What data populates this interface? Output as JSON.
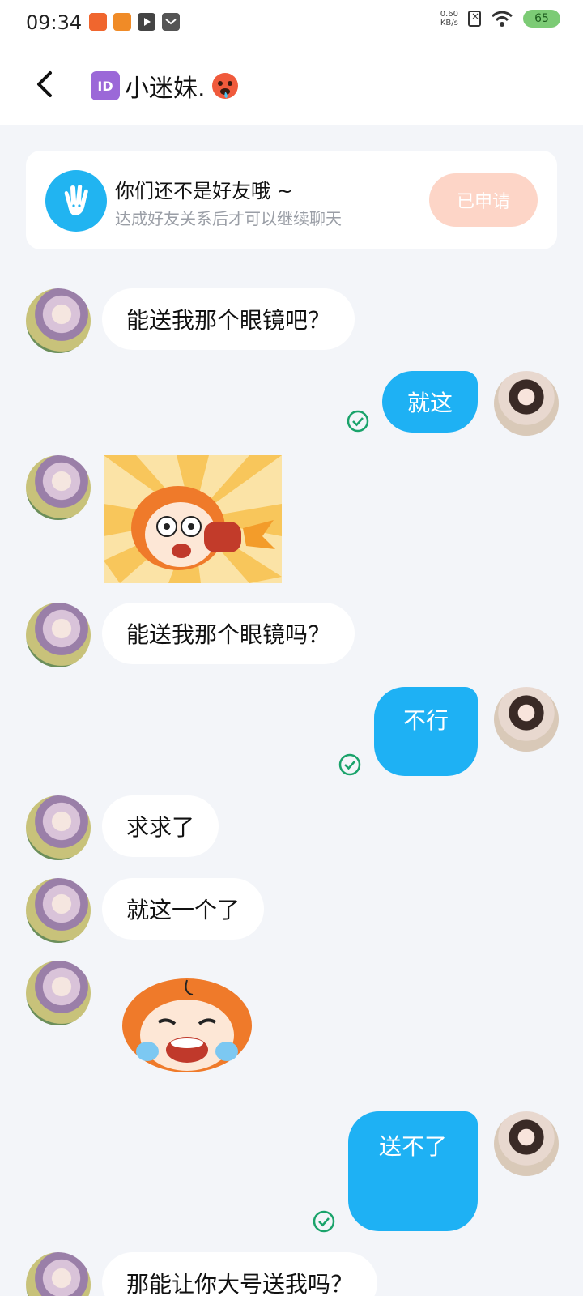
{
  "status_bar": {
    "time": "09:34",
    "net_speed_value": "0.60",
    "net_speed_unit": "KB/s",
    "battery": "65"
  },
  "header": {
    "id_badge": "ID",
    "title": "小迷妹."
  },
  "friend_notice": {
    "title": "你们还不是好友哦 ~",
    "subtitle": "达成好友关系后才可以继续聊天",
    "button_label": "已申请"
  },
  "messages": [
    {
      "from": "other",
      "type": "text",
      "text": "能送我那个眼镜吧？"
    },
    {
      "from": "self",
      "type": "text",
      "text": "就这",
      "status": "read"
    },
    {
      "from": "other",
      "type": "sticker",
      "sticker": "shocked-boxing-sticker"
    },
    {
      "from": "other",
      "type": "text",
      "text": "能送我那个眼镜吗？"
    },
    {
      "from": "self",
      "type": "text",
      "text": "不行",
      "status": "read"
    },
    {
      "from": "other",
      "type": "text",
      "text": "求求了"
    },
    {
      "from": "other",
      "type": "text",
      "text": "就这一个了"
    },
    {
      "from": "other",
      "type": "sticker",
      "sticker": "crying-sticker"
    },
    {
      "from": "self",
      "type": "text",
      "text": "送不了",
      "status": "read"
    },
    {
      "from": "other",
      "type": "text",
      "text": "那能让你大号送我吗？"
    }
  ],
  "colors": {
    "accent_blue": "#1eb1f4",
    "read_check": "#1aa36b",
    "applied_button": "#fdd5c7",
    "background": "#f3f5f9"
  }
}
